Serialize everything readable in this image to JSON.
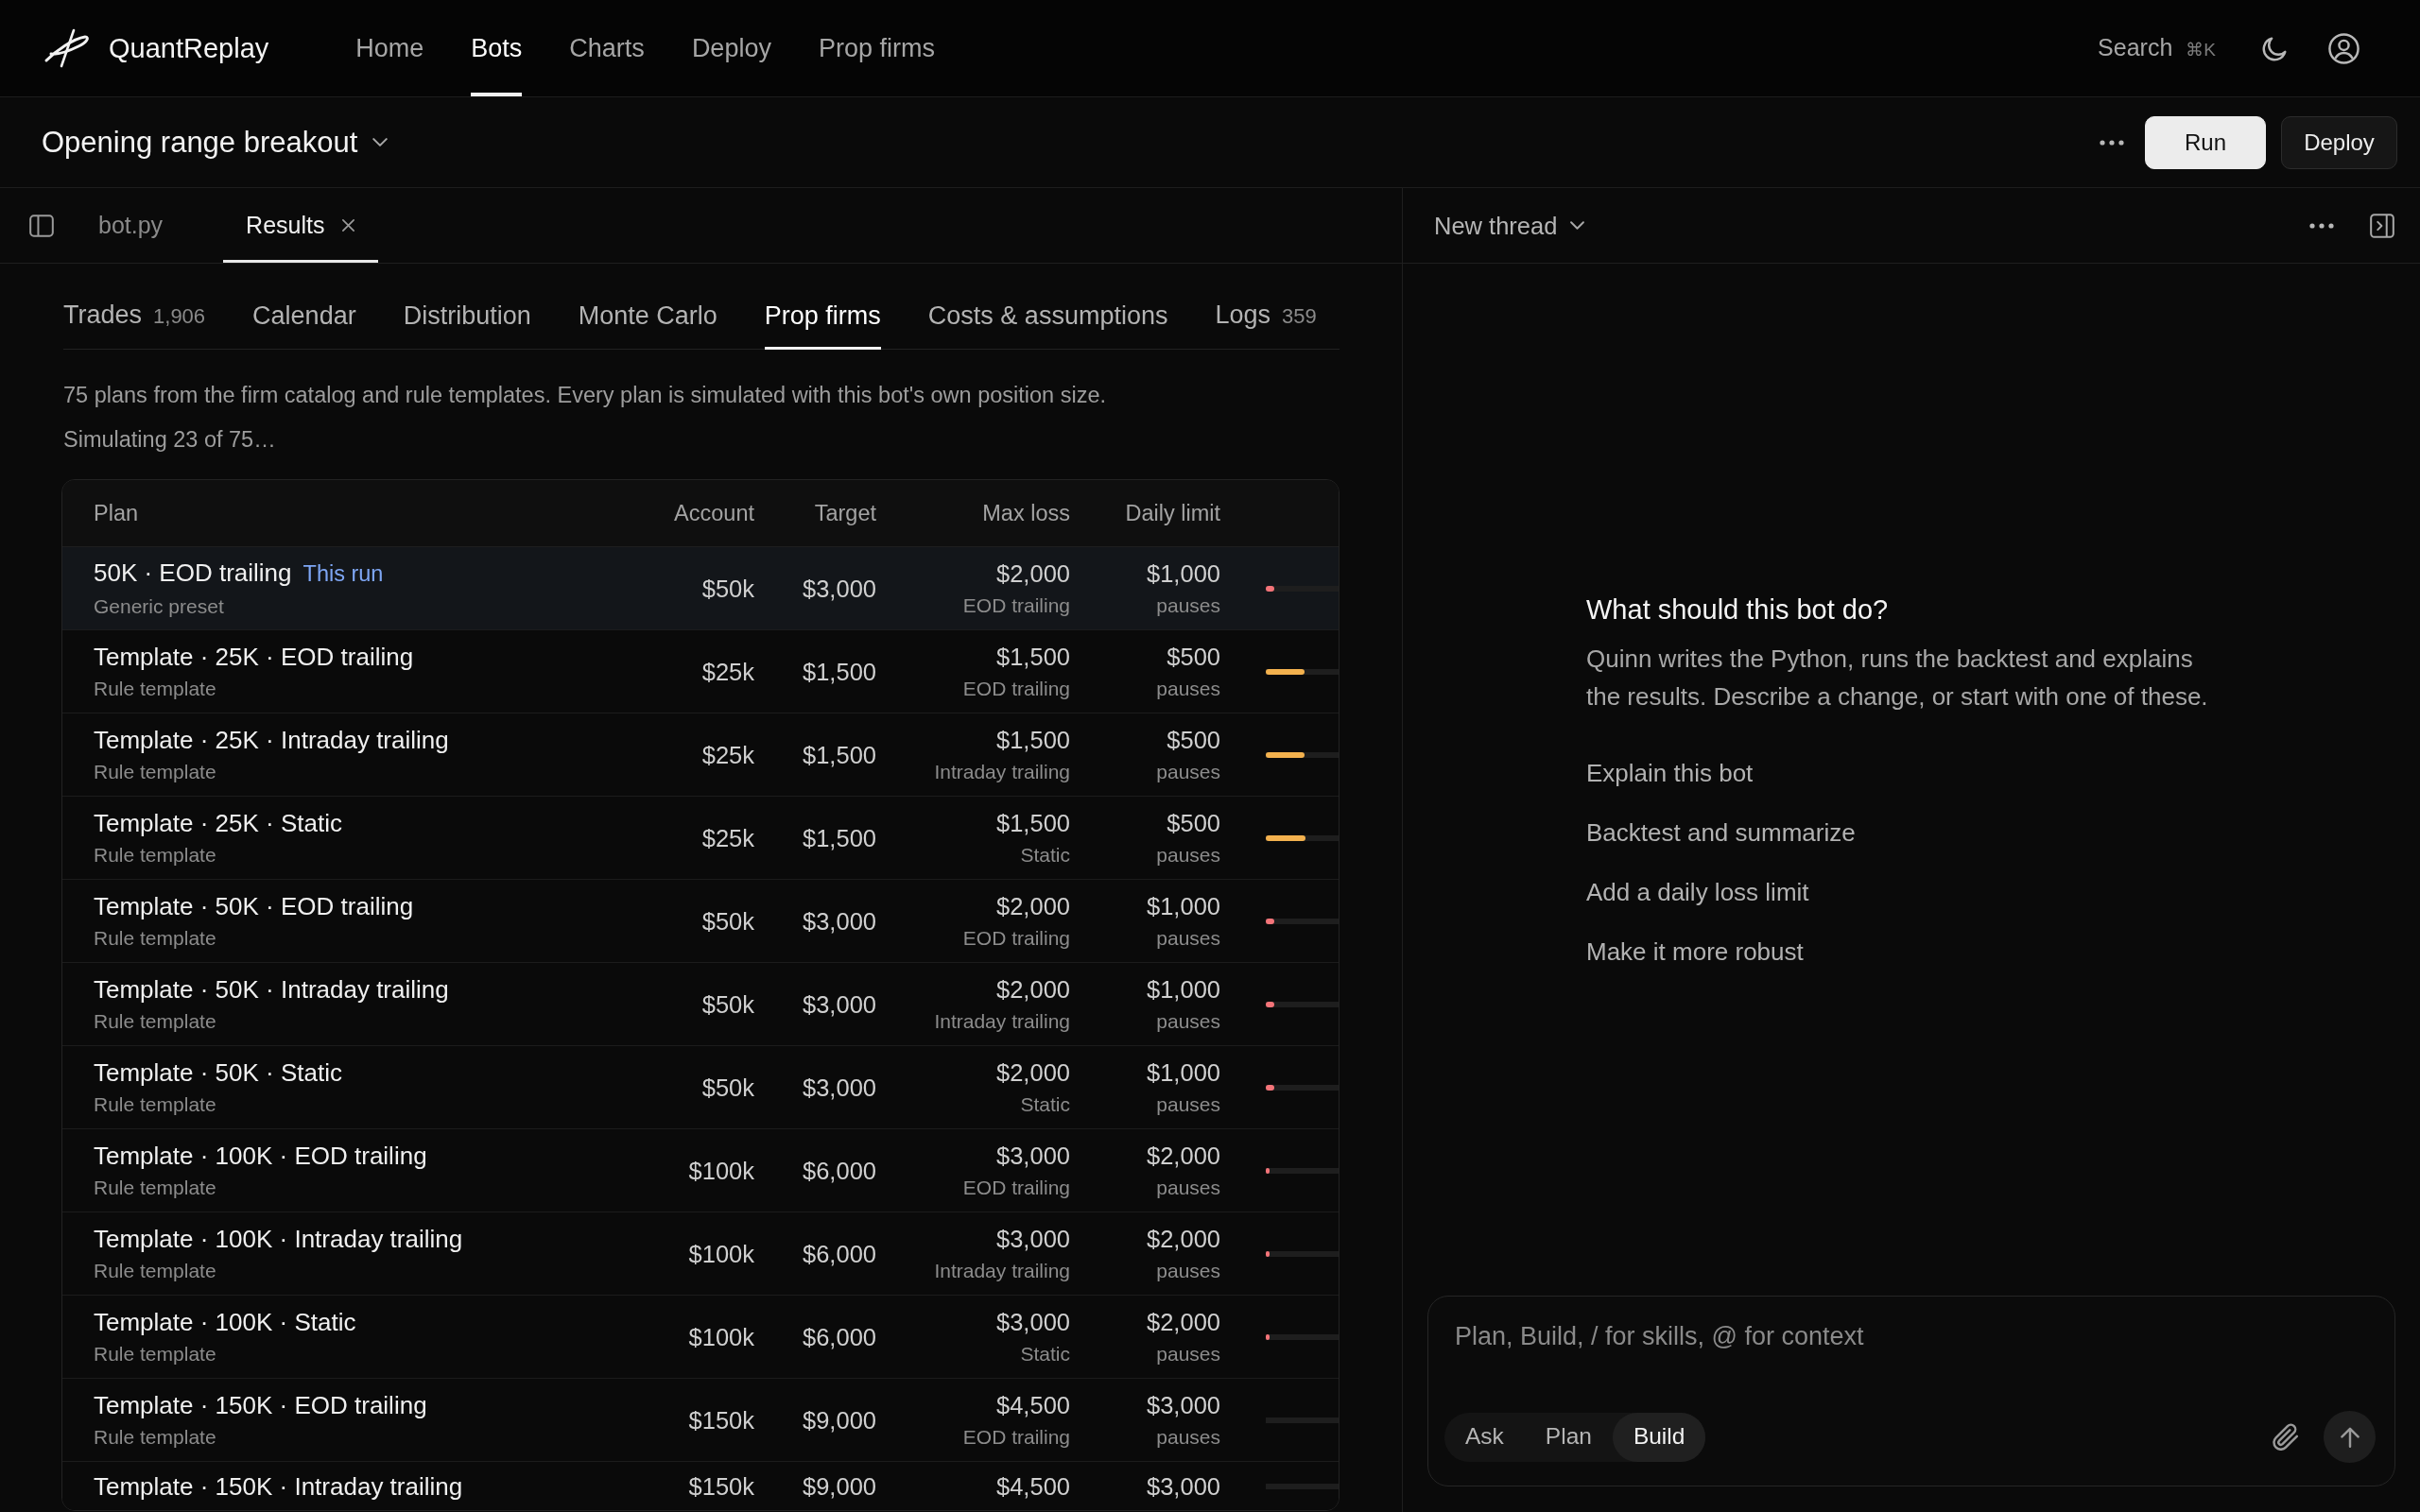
{
  "app": {
    "name": "QuantReplay"
  },
  "nav": [
    {
      "label": "Home",
      "selected": false
    },
    {
      "label": "Bots",
      "selected": true
    },
    {
      "label": "Charts",
      "selected": false
    },
    {
      "label": "Deploy",
      "selected": false
    },
    {
      "label": "Prop firms",
      "selected": false
    }
  ],
  "search": {
    "label": "Search",
    "shortcut": "⌘K"
  },
  "bot_title": "Opening range breakout",
  "actions": [
    {
      "label": "Run",
      "kind": "primary"
    },
    {
      "label": "Deploy",
      "kind": "secondary"
    }
  ],
  "editor_tabs": [
    {
      "label": "bot.py",
      "selected": false,
      "closable": false
    },
    {
      "label": "Results",
      "selected": true,
      "closable": true
    }
  ],
  "result_tabs": [
    {
      "label": "Trades",
      "count": "1,906",
      "selected": false
    },
    {
      "label": "Calendar",
      "selected": false
    },
    {
      "label": "Distribution",
      "selected": false
    },
    {
      "label": "Monte Carlo",
      "selected": false
    },
    {
      "label": "Prop firms",
      "selected": true
    },
    {
      "label": "Costs & assumptions",
      "selected": false
    },
    {
      "label": "Logs",
      "count": "359",
      "selected": false
    }
  ],
  "description": "75 plans from the firm catalog and rule templates. Every plan is simulated with this bot's own position size.",
  "progress_text": "Simulating 23 of 75…",
  "table": {
    "columns": [
      "Plan",
      "Account",
      "Target",
      "Max loss",
      "Daily limit"
    ],
    "rows": [
      {
        "plan": "50K · EOD trailing",
        "tag": "This run",
        "source": "Generic preset",
        "account": "$50k",
        "target": "$3,000",
        "max_loss": "$2,000",
        "max_loss_type": "EOD trailing",
        "daily_limit": "$1,000",
        "daily_limit_note": "pauses",
        "level": 0.12,
        "color": "#f47479",
        "selected": true
      },
      {
        "plan": "Template · 25K · EOD trailing",
        "source": "Rule template",
        "account": "$25k",
        "target": "$1,500",
        "max_loss": "$1,500",
        "max_loss_type": "EOD trailing",
        "daily_limit": "$500",
        "daily_limit_note": "pauses",
        "level": 0.53,
        "color": "#f3b14e",
        "selected": false
      },
      {
        "plan": "Template · 25K · Intraday trailing",
        "source": "Rule template",
        "account": "$25k",
        "target": "$1,500",
        "max_loss": "$1,500",
        "max_loss_type": "Intraday trailing",
        "daily_limit": "$500",
        "daily_limit_note": "pauses",
        "level": 0.53,
        "color": "#f3b14e",
        "selected": false
      },
      {
        "plan": "Template · 25K · Static",
        "source": "Rule template",
        "account": "$25k",
        "target": "$1,500",
        "max_loss": "$1,500",
        "max_loss_type": "Static",
        "daily_limit": "$500",
        "daily_limit_note": "pauses",
        "level": 0.54,
        "color": "#f3b14e",
        "selected": false
      },
      {
        "plan": "Template · 50K · EOD trailing",
        "source": "Rule template",
        "account": "$50k",
        "target": "$3,000",
        "max_loss": "$2,000",
        "max_loss_type": "EOD trailing",
        "daily_limit": "$1,000",
        "daily_limit_note": "pauses",
        "level": 0.12,
        "color": "#f47479",
        "selected": false
      },
      {
        "plan": "Template · 50K · Intraday trailing",
        "source": "Rule template",
        "account": "$50k",
        "target": "$3,000",
        "max_loss": "$2,000",
        "max_loss_type": "Intraday trailing",
        "daily_limit": "$1,000",
        "daily_limit_note": "pauses",
        "level": 0.12,
        "color": "#f47479",
        "selected": false
      },
      {
        "plan": "Template · 50K · Static",
        "source": "Rule template",
        "account": "$50k",
        "target": "$3,000",
        "max_loss": "$2,000",
        "max_loss_type": "Static",
        "daily_limit": "$1,000",
        "daily_limit_note": "pauses",
        "level": 0.12,
        "color": "#f47479",
        "selected": false
      },
      {
        "plan": "Template · 100K · EOD trailing",
        "source": "Rule template",
        "account": "$100k",
        "target": "$6,000",
        "max_loss": "$3,000",
        "max_loss_type": "EOD trailing",
        "daily_limit": "$2,000",
        "daily_limit_note": "pauses",
        "level": 0.05,
        "color": "#f47479",
        "selected": false
      },
      {
        "plan": "Template · 100K · Intraday trailing",
        "source": "Rule template",
        "account": "$100k",
        "target": "$6,000",
        "max_loss": "$3,000",
        "max_loss_type": "Intraday trailing",
        "daily_limit": "$2,000",
        "daily_limit_note": "pauses",
        "level": 0.05,
        "color": "#f47479",
        "selected": false
      },
      {
        "plan": "Template · 100K · Static",
        "source": "Rule template",
        "account": "$100k",
        "target": "$6,000",
        "max_loss": "$3,000",
        "max_loss_type": "Static",
        "daily_limit": "$2,000",
        "daily_limit_note": "pauses",
        "level": 0.05,
        "color": "#f47479",
        "selected": false
      },
      {
        "plan": "Template · 150K · EOD trailing",
        "source": "Rule template",
        "account": "$150k",
        "target": "$9,000",
        "max_loss": "$4,500",
        "max_loss_type": "EOD trailing",
        "daily_limit": "$3,000",
        "daily_limit_note": "pauses",
        "level": 0,
        "selected": false
      },
      {
        "plan": "Template · 150K · Intraday trailing",
        "account": "$150k",
        "target": "$9,000",
        "max_loss": "$4,500",
        "daily_limit": "$3,000",
        "level": 0,
        "selected": false
      }
    ]
  },
  "thread": {
    "title": "New thread",
    "heading": "What should this bot do?",
    "intro": "Quinn writes the Python, runs the backtest and explains the results. Describe a change, or start with one of these.",
    "suggestions": [
      "Explain this bot",
      "Backtest and summarize",
      "Add a daily loss limit",
      "Make it more robust"
    ]
  },
  "composer": {
    "placeholder": "Plan, Build, / for skills, @ for context",
    "modes": [
      {
        "label": "Ask",
        "selected": false
      },
      {
        "label": "Plan",
        "selected": false
      },
      {
        "label": "Build",
        "selected": true
      }
    ]
  }
}
